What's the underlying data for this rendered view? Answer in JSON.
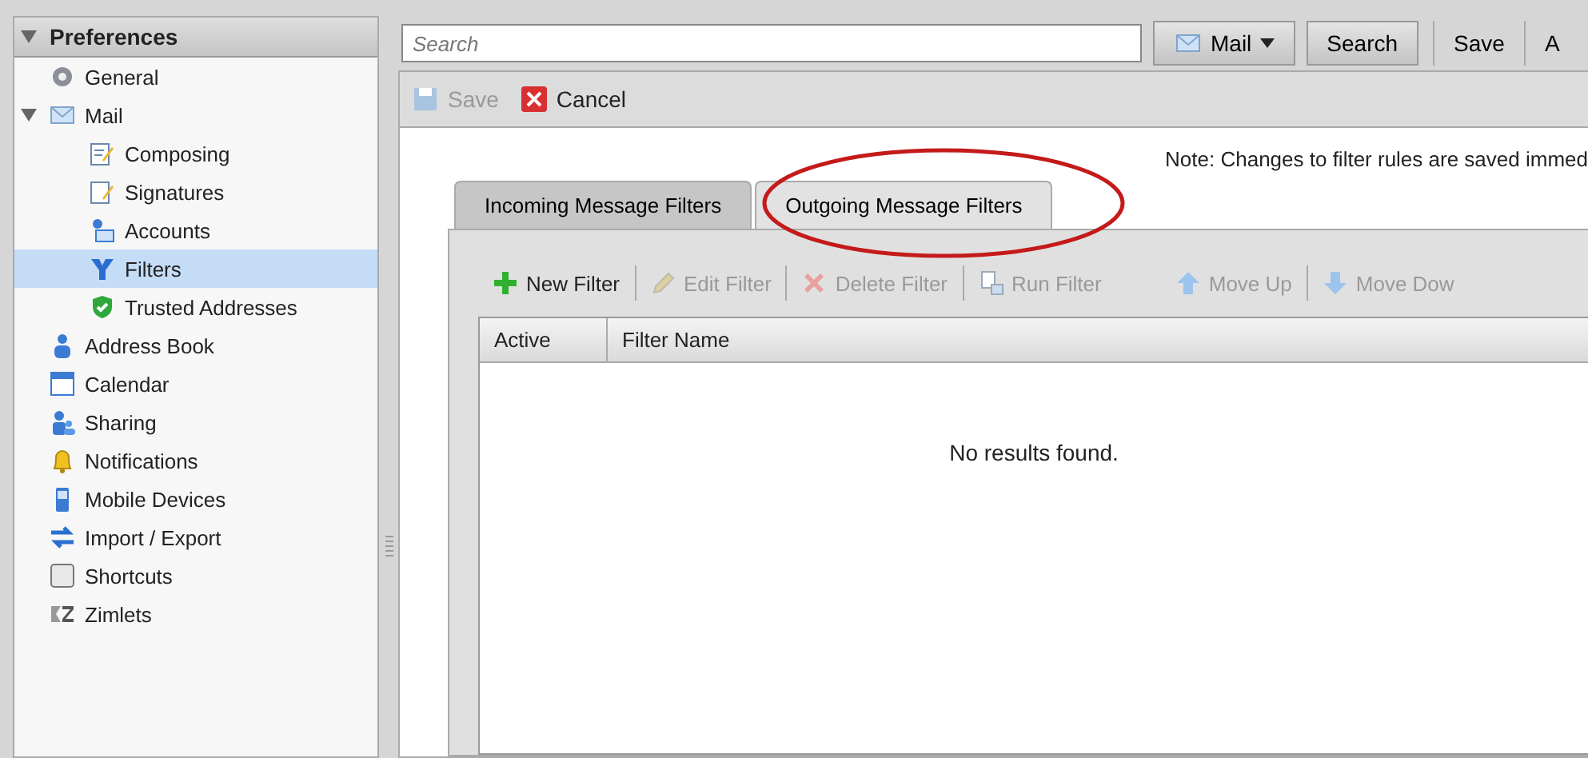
{
  "sidebar": {
    "title": "Preferences",
    "expanded": true,
    "items": [
      {
        "label": "General",
        "selected": false
      },
      {
        "label": "Mail",
        "selected": false,
        "expanded": true,
        "children": [
          {
            "label": "Composing",
            "selected": false
          },
          {
            "label": "Signatures",
            "selected": false
          },
          {
            "label": "Accounts",
            "selected": false
          },
          {
            "label": "Filters",
            "selected": true
          },
          {
            "label": "Trusted Addresses",
            "selected": false
          }
        ]
      },
      {
        "label": "Address Book",
        "selected": false
      },
      {
        "label": "Calendar",
        "selected": false
      },
      {
        "label": "Sharing",
        "selected": false
      },
      {
        "label": "Notifications",
        "selected": false
      },
      {
        "label": "Mobile Devices",
        "selected": false
      },
      {
        "label": "Import / Export",
        "selected": false
      },
      {
        "label": "Shortcuts",
        "selected": false
      },
      {
        "label": "Zimlets",
        "selected": false
      }
    ]
  },
  "search": {
    "placeholder": "Search",
    "scope": "Mail",
    "button": "Search",
    "actions": [
      "Save",
      "A"
    ]
  },
  "action_bar": [
    {
      "label": "Save",
      "disabled": true
    },
    {
      "label": "Cancel",
      "disabled": false
    }
  ],
  "note": "Note: Changes to filter rules are saved immed",
  "tabs": [
    {
      "label": "Incoming Message Filters",
      "selected": false
    },
    {
      "label": "Outgoing Message Filters",
      "selected": true
    }
  ],
  "toolbar": [
    {
      "label": "New Filter",
      "disabled": false
    },
    {
      "label": "Edit Filter",
      "disabled": true
    },
    {
      "label": "Delete Filter",
      "disabled": true
    },
    {
      "label": "Run Filter",
      "disabled": true
    },
    {
      "label": "Move Up",
      "disabled": true
    },
    {
      "label": "Move Dow",
      "disabled": true
    }
  ],
  "table": {
    "columns": [
      "Active",
      "Filter Name"
    ],
    "empty": "No results found."
  }
}
